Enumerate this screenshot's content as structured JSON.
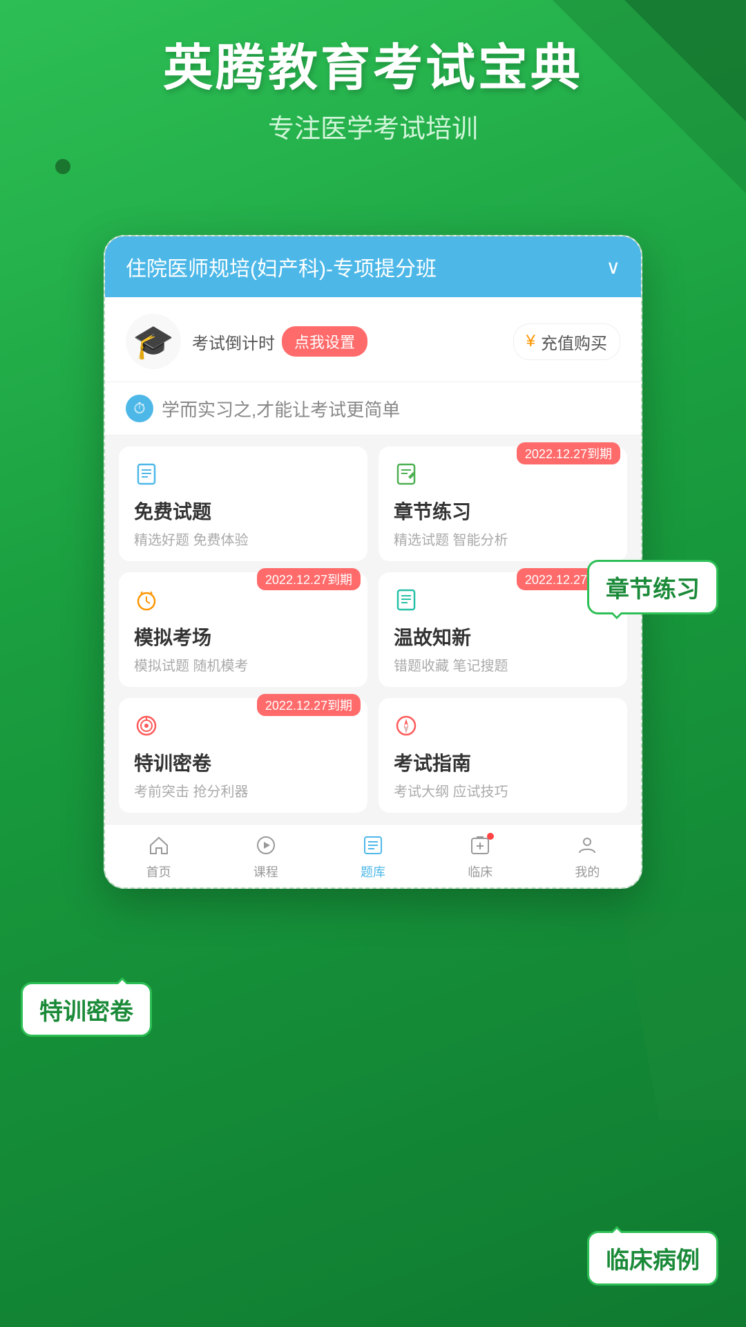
{
  "app": {
    "header_title": "英腾教育考试宝典",
    "header_subtitle": "专注医学考试培训"
  },
  "phone": {
    "course_bar": {
      "title": "住院医师规培(妇产科)-专项提分班",
      "arrow": "∨"
    },
    "countdown": {
      "label": "考试倒计时",
      "button": "点我设置"
    },
    "recharge": {
      "icon": "¥",
      "text": "充值购买"
    },
    "motto": {
      "text": "学而实习之,才能让考试更简单"
    },
    "functions": [
      {
        "id": "free-questions",
        "title": "免费试题",
        "desc": "精选好题 免费体验",
        "icon": "📋",
        "icon_type": "blue",
        "badge": null
      },
      {
        "id": "chapter-practice",
        "title": "章节练习",
        "desc": "精选试题 智能分析",
        "icon": "📝",
        "icon_type": "green",
        "badge": "2022.12.27到期"
      },
      {
        "id": "mock-exam",
        "title": "模拟考场",
        "desc": "模拟试题 随机模考",
        "icon": "⏰",
        "icon_type": "orange",
        "badge": "2022.12.27到期"
      },
      {
        "id": "review",
        "title": "温故知新",
        "desc": "错题收藏 笔记搜题",
        "icon": "📋",
        "icon_type": "teal",
        "badge": "2022.12.27到期"
      },
      {
        "id": "secret-paper",
        "title": "特训密卷",
        "desc": "考前突击 抢分利器",
        "icon": "🎯",
        "icon_type": "red",
        "badge": "2022.12.27到期"
      },
      {
        "id": "exam-guide",
        "title": "考试指南",
        "desc": "考试大纲 应试技巧",
        "icon": "🧭",
        "icon_type": "red",
        "badge": null
      }
    ],
    "nav": [
      {
        "id": "home",
        "label": "首页",
        "icon": "⌂",
        "active": false
      },
      {
        "id": "course",
        "label": "课程",
        "icon": "▷",
        "active": false
      },
      {
        "id": "question",
        "label": "题库",
        "icon": "☰",
        "active": true
      },
      {
        "id": "clinical",
        "label": "临床",
        "icon": "📋",
        "active": false,
        "dot": true
      },
      {
        "id": "mine",
        "label": "我的",
        "icon": "○",
        "active": false
      }
    ]
  },
  "callouts": {
    "chapter": "章节练习",
    "secret": "特训密卷",
    "clinical": "临床病例"
  }
}
